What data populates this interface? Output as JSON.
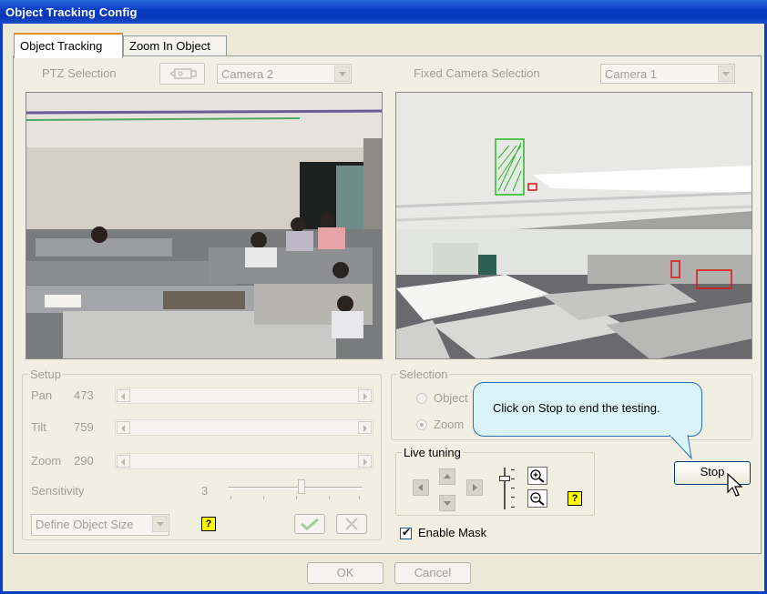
{
  "window": {
    "title": "Object Tracking Config"
  },
  "tabs": [
    {
      "label": "Object Tracking",
      "active": true
    },
    {
      "label": "Zoom In Object",
      "active": false
    }
  ],
  "ptz": {
    "label": "PTZ Selection",
    "camera": "Camera 2"
  },
  "fixed": {
    "label": "Fixed Camera Selection",
    "camera": "Camera 1"
  },
  "setup": {
    "legend": "Setup",
    "pan": {
      "label": "Pan",
      "value": "473"
    },
    "tilt": {
      "label": "Tilt",
      "value": "759"
    },
    "zoom": {
      "label": "Zoom",
      "value": "290"
    },
    "sensitivity": {
      "label": "Sensitivity",
      "value": "3",
      "level_fraction": 0.55
    },
    "define_object_size": "Define Object Size"
  },
  "selection": {
    "legend": "Selection",
    "option_object": "Object",
    "option_zoom": "Zoom",
    "selected": "Zoom"
  },
  "callout": {
    "text": "Click on Stop to end the testing."
  },
  "live_tuning": {
    "legend": "Live tuning"
  },
  "stop_button": "Stop",
  "enable_mask": {
    "label": "Enable Mask",
    "checked": true
  },
  "footer": {
    "ok": "OK",
    "cancel": "Cancel"
  },
  "icons": {
    "help": "?",
    "ptz": "camera-icon",
    "confirm": "checkmark-icon",
    "cancel_size": "x-icon"
  },
  "colors": {
    "titlebar": "#0a3fc4",
    "callout_bg": "#d9f3f9",
    "help_bg": "#ffff00",
    "tracking_box_green": "#1fbf1f",
    "tracking_box_red": "#e01010"
  }
}
